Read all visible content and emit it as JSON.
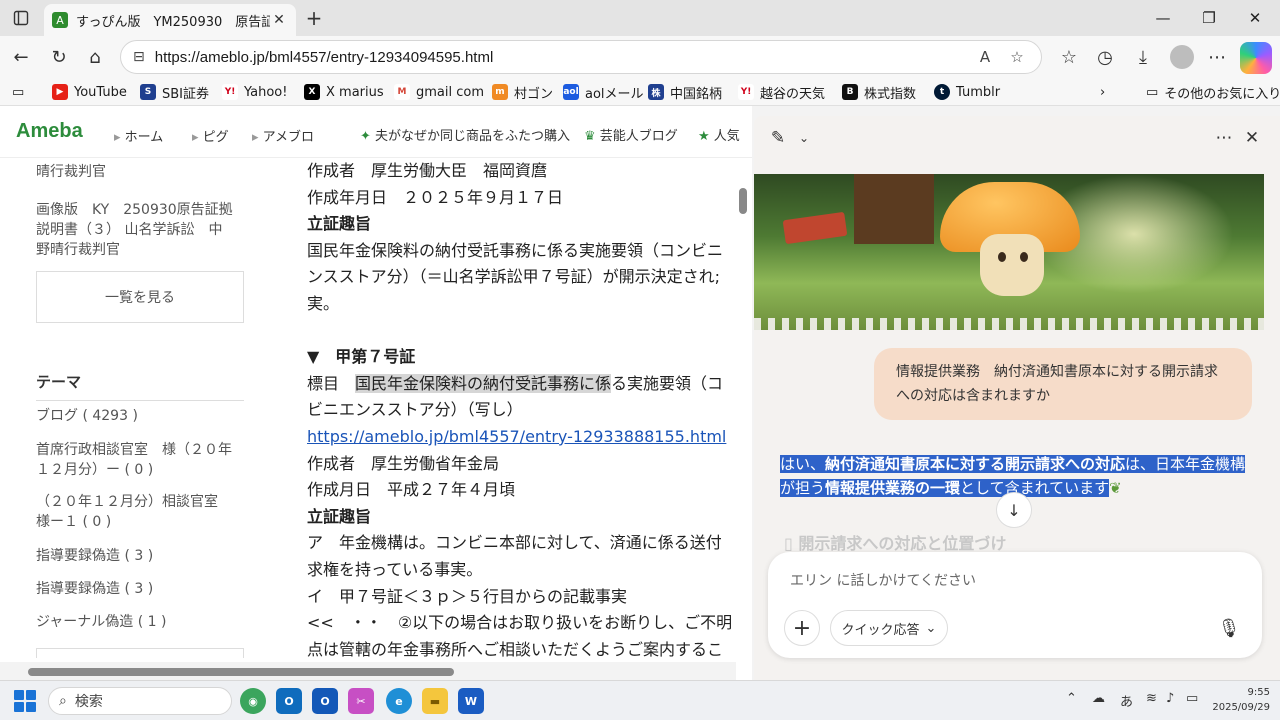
{
  "browser": {
    "tab_title": "すっぴん版　YM250930　原告証拠",
    "tab_favicon": "ameba-icon",
    "url": "https://ameblo.jp/bml4557/entry-12934094595.html",
    "read_aloud": "A",
    "bookmarks": [
      "YouTube",
      "SBI証券",
      "Yahoo!",
      "X marius",
      "gmail com",
      "村ゴン",
      "aolメール",
      "中国銘柄",
      "越谷の天気",
      "株式指数",
      "Tumblr"
    ],
    "other_favorites": "その他のお気に入り"
  },
  "ameba": {
    "logo": "Ameba",
    "nav": [
      "ホーム",
      "ピグ",
      "アメブロ"
    ],
    "promo1": "夫がなぜか同じ商品をふたつ購入",
    "promo2": "芸能人ブログ",
    "promo3": "人気"
  },
  "sidebar": {
    "line_top": "晴行裁判官",
    "entry_lines": [
      "画像版　KY　250930原告証拠",
      "説明書（３）  山名学訴訟　中",
      "野晴行裁判官"
    ],
    "view_list": "一覧を見る",
    "theme_heading": "テーマ",
    "themes": [
      "ブログ ( 4293 )",
      "首席行政相談官室　様（２０年",
      "１２月分）ー ( 0 )",
      "（２０年１２月分）相談官室",
      "様ー１ ( 0 )",
      "指導要録偽造 ( 3 )",
      "指導要録偽造 ( 3 )",
      "ジャーナル偽造 ( 1 )"
    ]
  },
  "article": {
    "l1": "作成者　厚生労働大臣　福岡資麿",
    "l2": "作成年月日　２０２５年９月１７日",
    "l3": "立証趣旨",
    "l4": "国民年金保険料の納付受託事務に係る実施要領（コンビニ",
    "l5": "ンスストア分）（＝山名学訴訟甲７号証）が開示決定され;",
    "l6": "実。",
    "l7": "▼　甲第７号証",
    "l8a": "標目　",
    "l8b": "国民年金保険料の納付受託事務に係",
    "l8c": "る実施要領（コ",
    "l9": "ビニエンスストア分）（写し）",
    "l10": "https://ameblo.jp/bml4557/entry-12933888155.html",
    "l11": "作成者　厚生労働省年金局",
    "l12": "作成月日　平成２７年４月頃",
    "l13": "立証趣旨",
    "l14": "ア　年金機構は。コンビニ本部に対して、済通に係る送付",
    "l15": "求権を持っている事実。",
    "l16": "イ　甲７号証＜３ｐ＞５行目からの記載事実",
    "l17": "<<　・・　②以下の場合はお取り扱いをお断りし、ご不明",
    "l18": "点は管轄の年金事務所へご相談いただくようご案内するこ"
  },
  "copilot": {
    "user_message": "情報提供業務　納付済通知書原本に対する開示請求への対応は含まれますか",
    "answer_p1": "はい、",
    "answer_b1": "納付済通知書原本に対する開示請求への対応",
    "answer_p2": "は、日本年金機構が担う",
    "answer_b2": "情報提供業務の一環",
    "answer_p3": "として含まれています",
    "faded_heading": "開示請求への対応と位置づけ",
    "composer_placeholder": "エリン に話しかけてください",
    "quick_reply": "クイック応答"
  },
  "taskbar": {
    "search_label": "検索",
    "ime": "あ",
    "time": "9:55",
    "date": "2025/09/29"
  }
}
